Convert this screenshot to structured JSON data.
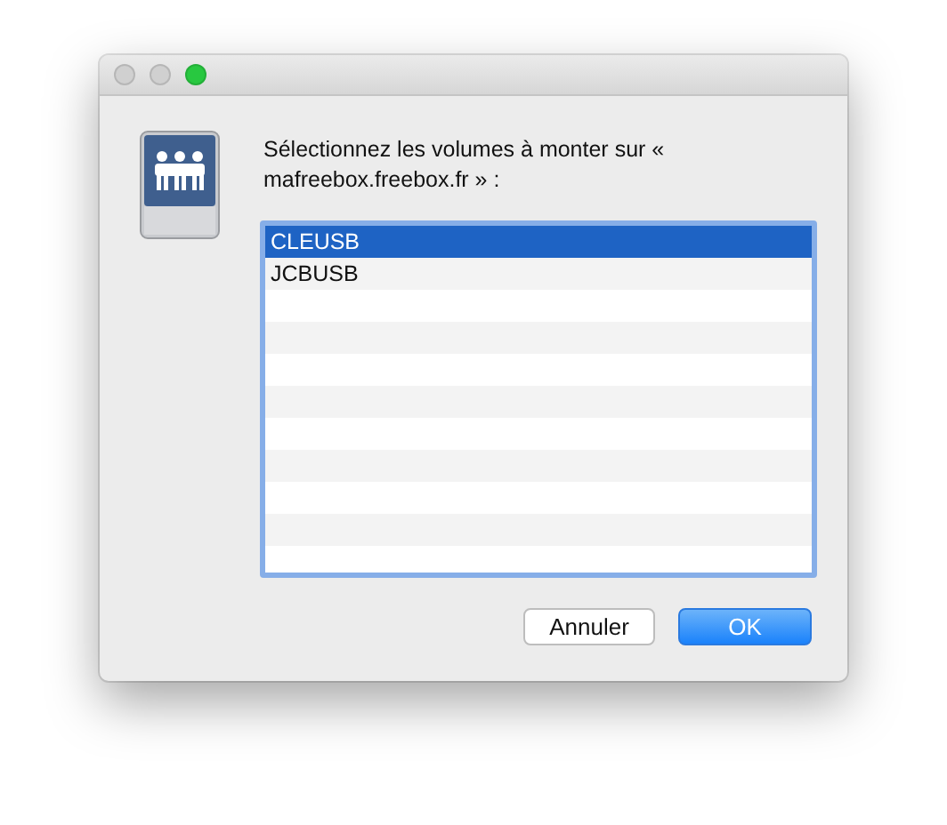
{
  "window": {
    "controls": [
      {
        "kind": "close",
        "enabled": false
      },
      {
        "kind": "minimize",
        "enabled": false
      },
      {
        "kind": "zoom",
        "enabled": true
      }
    ]
  },
  "message": "Sélectionnez les volumes à monter sur « mafreebox.freebox.fr » :",
  "volumes": [
    {
      "name": "CLEUSB",
      "selected": true
    },
    {
      "name": "JCBUSB",
      "selected": false
    }
  ],
  "buttons": [
    {
      "label": "Annuler",
      "kind": "cancel"
    },
    {
      "label": "OK",
      "kind": "default"
    }
  ]
}
